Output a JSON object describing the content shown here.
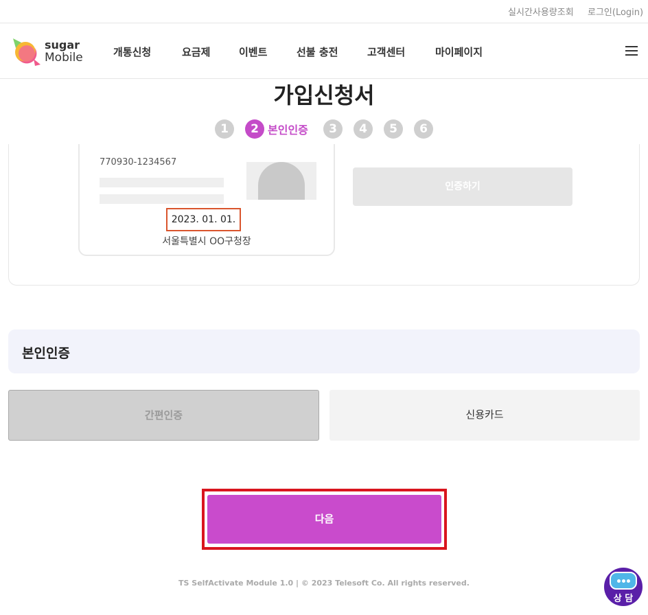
{
  "utility": {
    "usage_lookup": "실시간사용량조회",
    "login": "로그인(Login)"
  },
  "brand": {
    "line1": "sugar",
    "line2": "Mobile",
    "colors": {
      "primary": "#c94bcc",
      "logo_pink": "#f05a8c",
      "logo_orange": "#f7b733",
      "logo_green": "#7fd36b"
    }
  },
  "nav": {
    "items": [
      "개통신청",
      "요금제",
      "이벤트",
      "선불 충전",
      "고객센터",
      "마이페이지"
    ],
    "menu_icon": "hamburger-icon"
  },
  "page": {
    "title": "가입신청서"
  },
  "steps": {
    "items": [
      "1",
      "2",
      "3",
      "4",
      "5",
      "6"
    ],
    "active_index": 1,
    "active_label": "본인인증"
  },
  "id_card": {
    "number": "770930-1234567",
    "issue_date": "2023. 01. 01.",
    "issuer": "서울특별시 OO구청장"
  },
  "verify_button": "인증하기",
  "verification": {
    "section_title": "본인인증",
    "option_simple": "간편인증",
    "option_card": "신용카드"
  },
  "next_button": "다음",
  "footer": "TS SelfActivate Module 1.0 | © 2023 Telesoft Co. All rights reserved.",
  "chat": {
    "label": "상 담",
    "icon": "chat-bubble-icon"
  }
}
